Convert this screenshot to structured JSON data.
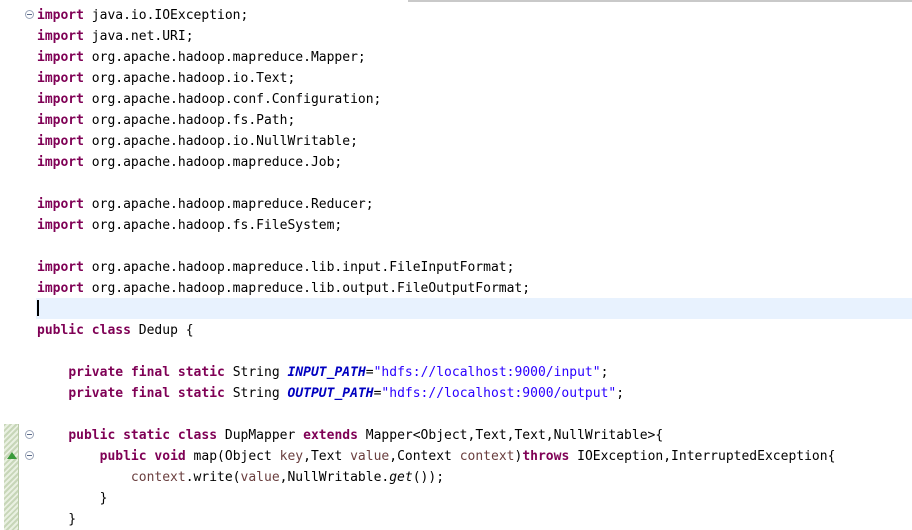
{
  "editor": {
    "lines": [
      [
        {
          "t": "import",
          "c": "kw"
        },
        {
          "t": " java.io.IOException;"
        }
      ],
      [
        {
          "t": "import",
          "c": "kw"
        },
        {
          "t": " java.net.URI;"
        }
      ],
      [
        {
          "t": "import",
          "c": "kw"
        },
        {
          "t": " org.apache.hadoop.mapreduce.Mapper;"
        }
      ],
      [
        {
          "t": "import",
          "c": "kw"
        },
        {
          "t": " org.apache.hadoop.io.Text;"
        }
      ],
      [
        {
          "t": "import",
          "c": "kw"
        },
        {
          "t": " org.apache.hadoop.conf.Configuration;"
        }
      ],
      [
        {
          "t": "import",
          "c": "kw"
        },
        {
          "t": " org.apache.hadoop.fs.Path;"
        }
      ],
      [
        {
          "t": "import",
          "c": "kw"
        },
        {
          "t": " org.apache.hadoop.io.NullWritable;"
        }
      ],
      [
        {
          "t": "import",
          "c": "kw"
        },
        {
          "t": " org.apache.hadoop.mapreduce.Job;"
        }
      ],
      [],
      [
        {
          "t": "import",
          "c": "kw"
        },
        {
          "t": " org.apache.hadoop.mapreduce.Reducer;"
        }
      ],
      [
        {
          "t": "import",
          "c": "kw"
        },
        {
          "t": " org.apache.hadoop.fs.FileSystem;"
        }
      ],
      [],
      [
        {
          "t": "import",
          "c": "kw"
        },
        {
          "t": " org.apache.hadoop.mapreduce.lib.input.FileInputFormat;"
        }
      ],
      [
        {
          "t": "import",
          "c": "kw"
        },
        {
          "t": " org.apache.hadoop.mapreduce.lib.output.FileOutputFormat;"
        }
      ],
      [],
      [
        {
          "t": "public",
          "c": "kw"
        },
        {
          "t": " "
        },
        {
          "t": "class",
          "c": "kw"
        },
        {
          "t": " Dedup {"
        }
      ],
      [],
      [
        {
          "t": "    "
        },
        {
          "t": "private",
          "c": "kw"
        },
        {
          "t": " "
        },
        {
          "t": "final",
          "c": "kw"
        },
        {
          "t": " "
        },
        {
          "t": "static",
          "c": "kw"
        },
        {
          "t": " String "
        },
        {
          "t": "INPUT_PATH",
          "c": "fld"
        },
        {
          "t": "="
        },
        {
          "t": "\"hdfs://localhost:9000/input\"",
          "c": "str"
        },
        {
          "t": ";"
        }
      ],
      [
        {
          "t": "    "
        },
        {
          "t": "private",
          "c": "kw"
        },
        {
          "t": " "
        },
        {
          "t": "final",
          "c": "kw"
        },
        {
          "t": " "
        },
        {
          "t": "static",
          "c": "kw"
        },
        {
          "t": " String "
        },
        {
          "t": "OUTPUT_PATH",
          "c": "fld"
        },
        {
          "t": "="
        },
        {
          "t": "\"hdfs://localhost:9000/output\"",
          "c": "str"
        },
        {
          "t": ";"
        }
      ],
      [],
      [
        {
          "t": "    "
        },
        {
          "t": "public",
          "c": "kw"
        },
        {
          "t": " "
        },
        {
          "t": "static",
          "c": "kw"
        },
        {
          "t": " "
        },
        {
          "t": "class",
          "c": "kw"
        },
        {
          "t": " DupMapper "
        },
        {
          "t": "extends",
          "c": "kw"
        },
        {
          "t": " Mapper<Object,Text,Text,NullWritable>{"
        }
      ],
      [
        {
          "t": "        "
        },
        {
          "t": "public",
          "c": "kw"
        },
        {
          "t": " "
        },
        {
          "t": "void",
          "c": "kw"
        },
        {
          "t": " map(Object "
        },
        {
          "t": "key",
          "c": "var"
        },
        {
          "t": ",Text "
        },
        {
          "t": "value",
          "c": "var"
        },
        {
          "t": ",Context "
        },
        {
          "t": "context",
          "c": "var"
        },
        {
          "t": ")"
        },
        {
          "t": "throws",
          "c": "kw"
        },
        {
          "t": " IOException,InterruptedException{"
        }
      ],
      [
        {
          "t": "            "
        },
        {
          "t": "context",
          "c": "var"
        },
        {
          "t": ".write("
        },
        {
          "t": "value",
          "c": "var"
        },
        {
          "t": ",NullWritable."
        },
        {
          "t": "get",
          "c": "stat"
        },
        {
          "t": "());"
        }
      ],
      [
        {
          "t": "        }"
        }
      ],
      [
        {
          "t": "    }"
        }
      ]
    ]
  }
}
